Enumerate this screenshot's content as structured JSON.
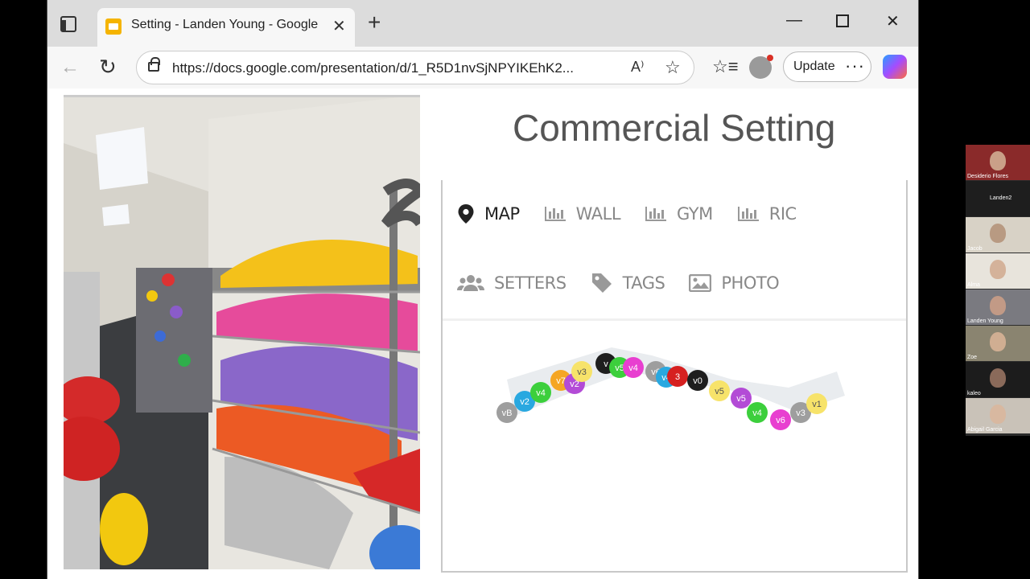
{
  "browser": {
    "tab_title": "Setting - Landen Young - Google",
    "url": "https://docs.google.com/presentation/d/1_R5D1nvSjNPYIKEhK2...",
    "update_label": "Update"
  },
  "slide": {
    "title": "Commercial Setting"
  },
  "app": {
    "nav_row1": [
      {
        "label": "MAP",
        "icon": "map-pin-icon"
      },
      {
        "label": "WALL",
        "icon": "bar-chart-icon"
      },
      {
        "label": "GYM",
        "icon": "bar-chart-icon"
      },
      {
        "label": "RIC",
        "icon": "bar-chart-icon"
      }
    ],
    "nav_row2": [
      {
        "label": "SETTERS",
        "icon": "users-icon"
      },
      {
        "label": "TAGS",
        "icon": "tag-icon"
      },
      {
        "label": "PHOTO",
        "icon": "image-icon"
      }
    ],
    "route_markers": [
      {
        "grade": "vB",
        "color": "#9e9e9e"
      },
      {
        "grade": "v2",
        "color": "#29a8e0"
      },
      {
        "grade": "v4",
        "color": "#3ccf3c"
      },
      {
        "grade": "v7",
        "color": "#f5a623"
      },
      {
        "grade": "v2",
        "color": "#b34bd6"
      },
      {
        "grade": "v3",
        "color": "#f7e36a"
      },
      {
        "grade": "v",
        "color": "#1e1e1e"
      },
      {
        "grade": "v5",
        "color": "#3ccf3c"
      },
      {
        "grade": "v4",
        "color": "#e83fd0"
      },
      {
        "grade": "v6",
        "color": "#9e9e9e"
      },
      {
        "grade": "v4",
        "color": "#29a8e0"
      },
      {
        "grade": "3",
        "color": "#d62020"
      },
      {
        "grade": "v0",
        "color": "#1e1e1e"
      },
      {
        "grade": "v5",
        "color": "#f7e36a"
      },
      {
        "grade": "v5",
        "color": "#b34bd6"
      },
      {
        "grade": "v4",
        "color": "#3ccf3c"
      },
      {
        "grade": "v6",
        "color": "#e83fd0"
      },
      {
        "grade": "v3",
        "color": "#9e9e9e"
      },
      {
        "grade": "v1",
        "color": "#f7e36a"
      }
    ]
  },
  "participants": [
    {
      "name": "Desiderio Flores",
      "bg": "#8a2a2a",
      "skin": "#caa088"
    },
    {
      "name": "Landen2",
      "bg": "#1e1e1e",
      "skin": ""
    },
    {
      "name": "Jacob",
      "bg": "#d8d2c6",
      "skin": "#b89a82"
    },
    {
      "name": "Alma",
      "bg": "#e8e4dc",
      "skin": "#d4b29a"
    },
    {
      "name": "Landen Young",
      "bg": "#7a7a80",
      "skin": "#c29a86"
    },
    {
      "name": "Zoe",
      "bg": "#8a8470",
      "skin": "#d0ae92"
    },
    {
      "name": "kaleo",
      "bg": "#1c1c1c",
      "skin": "#8a6a5a"
    },
    {
      "name": "Abigail Garcia",
      "bg": "#c9c2b8",
      "skin": "#d8b8a0"
    }
  ]
}
